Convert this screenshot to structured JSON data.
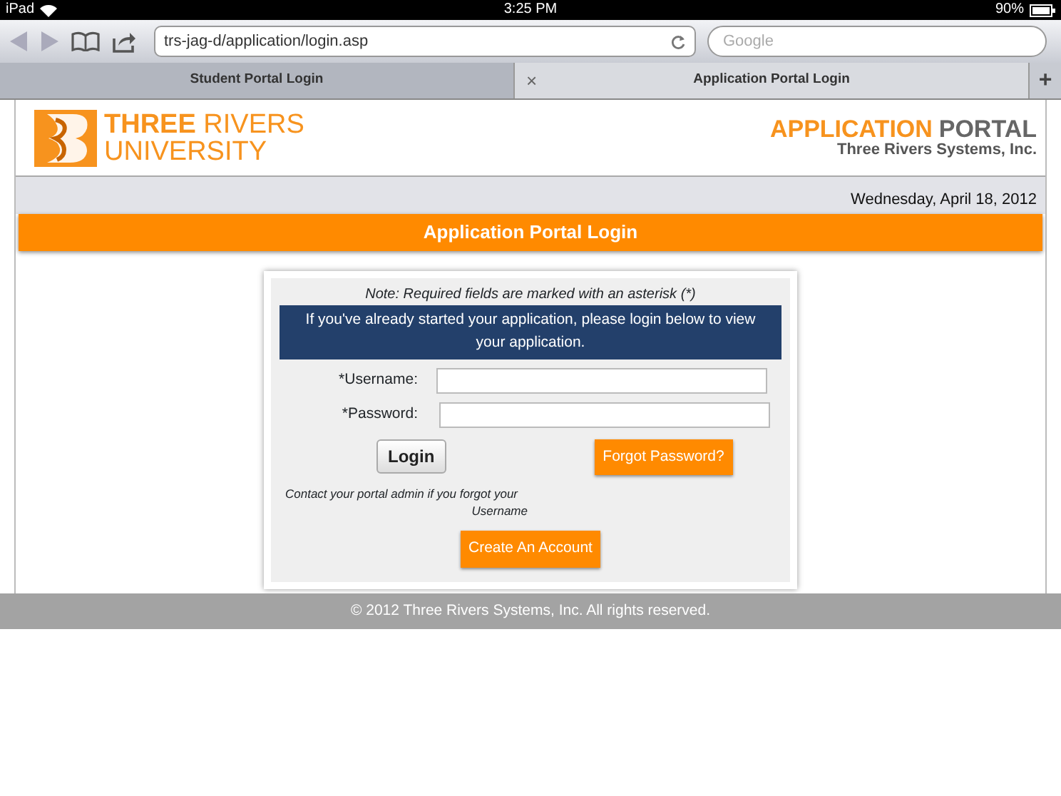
{
  "status_bar": {
    "device": "iPad",
    "time": "3:25 PM",
    "battery": "90%"
  },
  "browser": {
    "url": "trs-jag-d/application/login.asp",
    "search_placeholder": "Google",
    "tabs": [
      {
        "label": "Student Portal Login",
        "selected": false
      },
      {
        "label": "Application Portal Login",
        "selected": true,
        "close": "×"
      }
    ],
    "new_tab": "+"
  },
  "header": {
    "logo_line1_bold": "THREE",
    "logo_line1": "RIVERS",
    "logo_line2": "UNIVERSITY",
    "portal_title_accent": "APPLICATION",
    "portal_title": "PORTAL",
    "company": "Three Rivers Systems, Inc."
  },
  "date": "Wednesday, April 18, 2012",
  "page_title": "Application Portal Login",
  "login": {
    "note": "Note: Required fields are marked with an asterisk (*)",
    "banner": "If you've already started your application, please login below to view your application.",
    "fields": [
      {
        "label": "*Username:"
      },
      {
        "label": "*Password:"
      }
    ],
    "login_button": "Login",
    "forgot_button": "Forgot Password?",
    "contact_note": "Contact your portal admin if you forgot your Username",
    "create_button": "Create An Account"
  },
  "footer": "© 2012 Three Rivers Systems, Inc. All rights reserved."
}
